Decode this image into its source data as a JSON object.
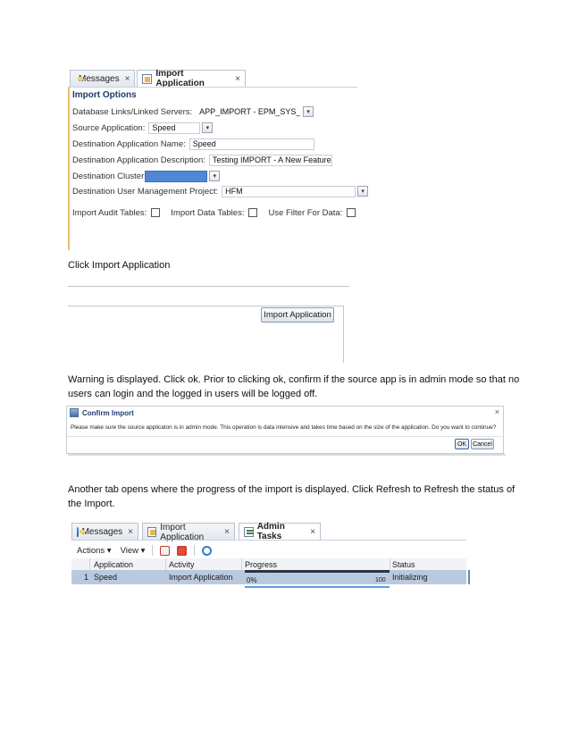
{
  "import_dialog": {
    "tabs": [
      {
        "label": "Messages",
        "close": "×"
      },
      {
        "label": "Import Application",
        "close": "×"
      }
    ],
    "section_title": "Import Options",
    "fields": {
      "db_links_label": "Database Links/Linked Servers:",
      "db_links_value": "APP_IMPORT - EPM_SYS_HFM",
      "source_app_label": "Source Application:",
      "source_app_value": "Speed",
      "dest_app_name_label": "Destination Application Name:",
      "dest_app_name_value": "Speed",
      "dest_app_desc_label": "Destination Application Description:",
      "dest_app_desc_value": "Testing IMPORT - A New Feature",
      "dest_cluster_label": "Destination Cluster",
      "dest_ump_label": "Destination User Management Project:",
      "dest_ump_value": "HFM"
    },
    "checkboxes": {
      "audit_label": "Import Audit Tables:",
      "data_label": "Import Data Tables:",
      "filter_label": "Use Filter For Data:"
    },
    "dropdown_glyph": "▾"
  },
  "captions": {
    "click_import": "Click Import Application",
    "warning_line1": "Warning is displayed. Click ok. Prior to clicking ok, confirm if the source app is in admin mode so that no",
    "warning_line2": "users can login and the logged in users will be logged off.",
    "progress_line1": "Another tab opens where the progress of the import is displayed. Click Refresh to Refresh the status of",
    "progress_line2": "the Import."
  },
  "import_button": {
    "label": "Import Application"
  },
  "confirm_dialog": {
    "title": "Confirm Import",
    "close": "×",
    "message": "Please make sure the source applicaton is in admin mode. This operation is data intensive and takes time based on the size of the application. Do you want to continue?",
    "ok_label": "OK",
    "cancel_label": "Cancel"
  },
  "admin_tasks": {
    "tabs": [
      {
        "label": "Messages",
        "close": "×"
      },
      {
        "label": "Import Application",
        "close": "×"
      },
      {
        "label": "Admin Tasks",
        "close": "×"
      }
    ],
    "toolbar": {
      "actions_label": "Actions ▾",
      "view_label": "View ▾"
    },
    "columns": [
      "Application",
      "Activity",
      "Progress",
      "Status"
    ],
    "rows": [
      {
        "num": "1",
        "application": "Speed",
        "activity": "Import Application",
        "progress_start": "0%",
        "progress_end": "100",
        "status": "Initializing"
      }
    ],
    "colors": {
      "row_selected": "#b9c9df",
      "progress_bar": "#5f9be0"
    }
  }
}
